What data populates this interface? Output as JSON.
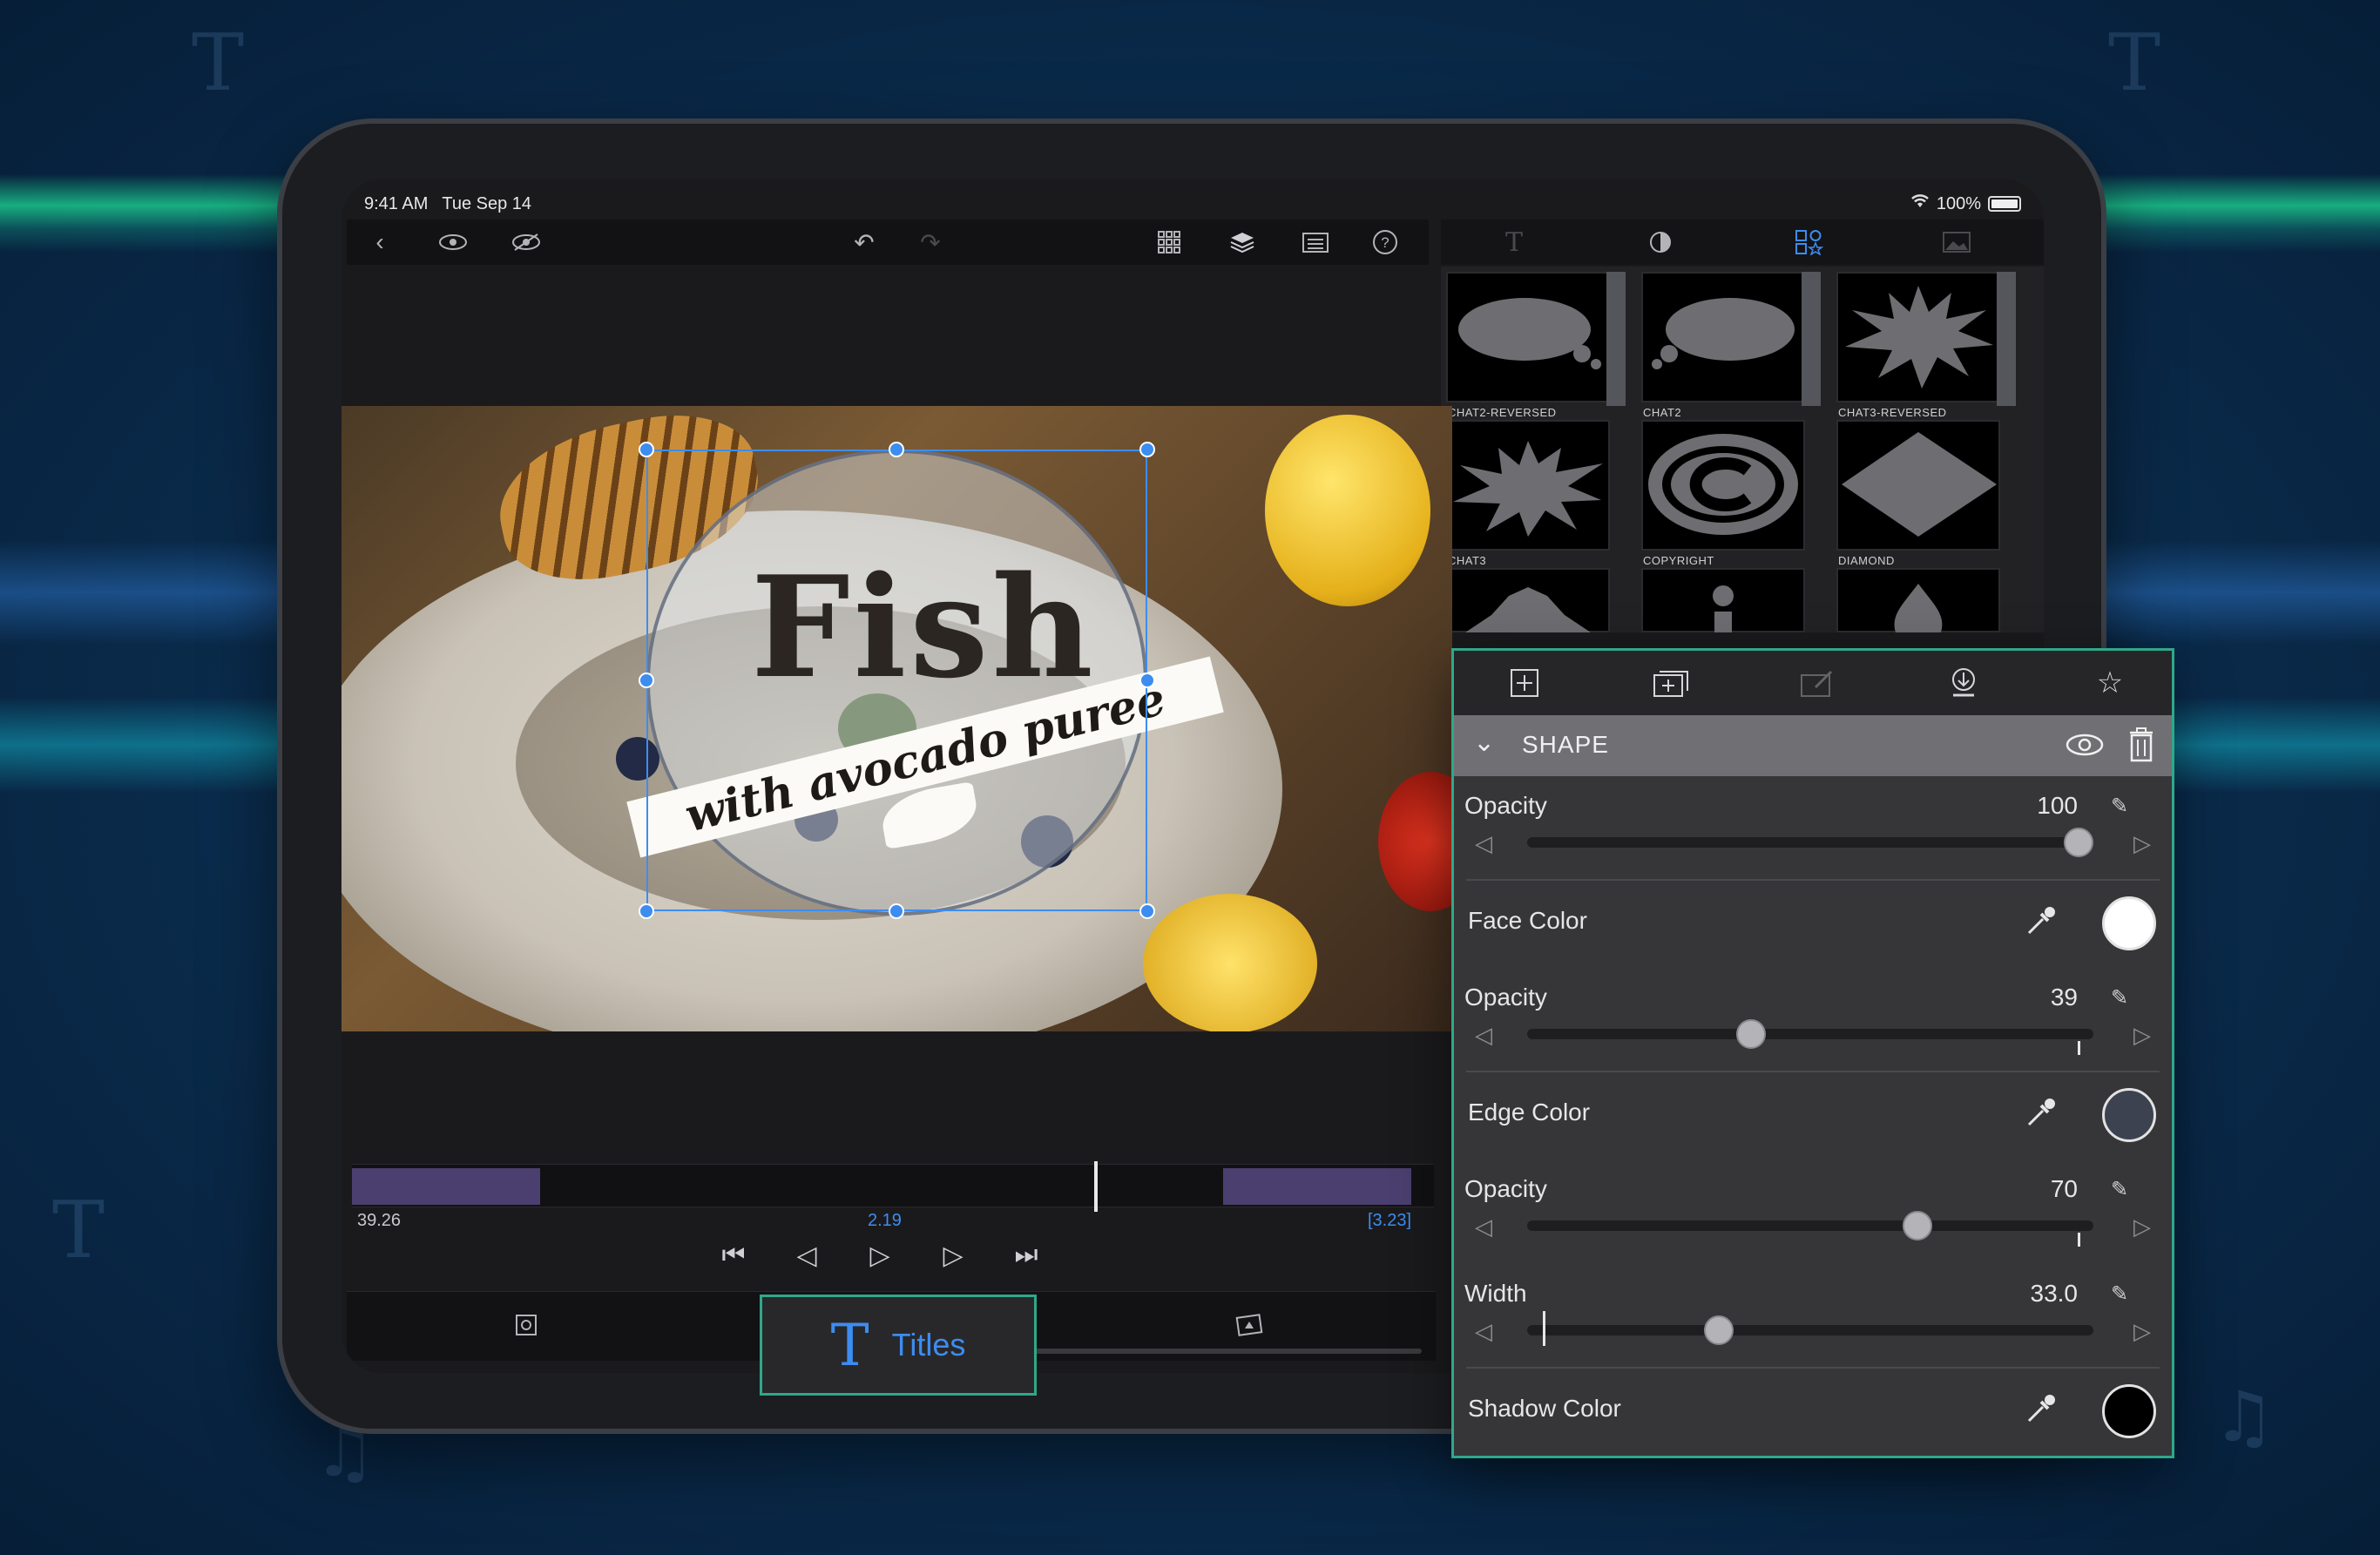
{
  "status": {
    "time": "9:41 AM",
    "date": "Tue Sep 14",
    "battery": "100%"
  },
  "toolbar": {
    "icons": [
      "back-icon",
      "eye-icon",
      "eye-hide-icon",
      "undo-icon",
      "redo-icon",
      "grid-icon",
      "layers-icon",
      "clipboard-icon",
      "help-icon"
    ]
  },
  "right_tabs": [
    "text-tab-icon",
    "color-tab-icon",
    "shapes-tab-icon",
    "image-tab-icon"
  ],
  "shapes": [
    {
      "name": "CHAT2-REVERSED"
    },
    {
      "name": "CHAT2"
    },
    {
      "name": "CHAT3-REVERSED"
    },
    {
      "name": "CHAT3"
    },
    {
      "name": "COPYRIGHT"
    },
    {
      "name": "DIAMOND"
    }
  ],
  "preview": {
    "title": "Fish",
    "subtitle": "with avocado puree"
  },
  "timeline": {
    "start": "39.26",
    "current": "2.19",
    "end": "[3.23]"
  },
  "bottom_tab": {
    "label": "Titles"
  },
  "panel": {
    "section": "SHAPE",
    "shape_opacity": {
      "label": "Opacity",
      "value": "100",
      "level": 1.0
    },
    "face_color": {
      "label": "Face Color",
      "color": "#ffffff"
    },
    "face_opacity": {
      "label": "Opacity",
      "value": "39",
      "level": 0.39
    },
    "edge_color": {
      "label": "Edge Color",
      "color": "#3c4250"
    },
    "edge_opacity": {
      "label": "Opacity",
      "value": "70",
      "level": 0.7
    },
    "width": {
      "label": "Width",
      "value": "33.0",
      "level": 0.33
    },
    "shadow_color": {
      "label": "Shadow Color",
      "color": "#000000"
    }
  }
}
